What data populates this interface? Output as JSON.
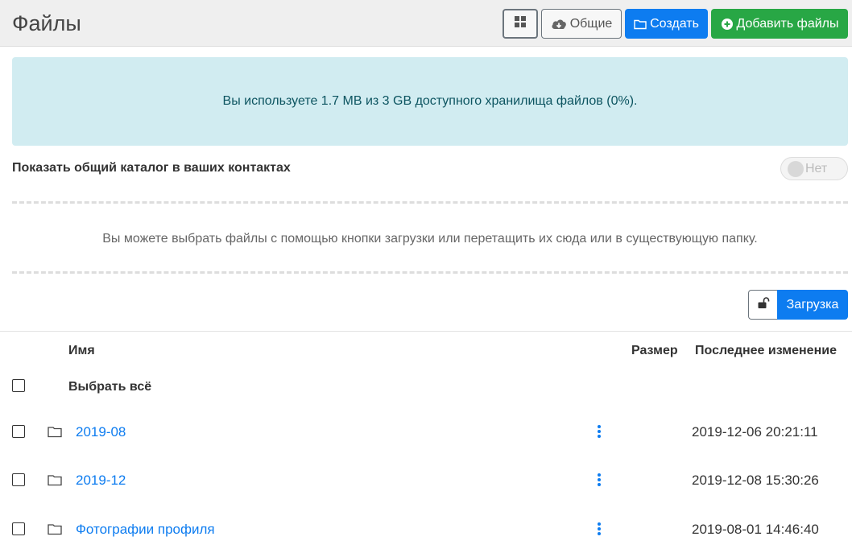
{
  "header": {
    "title": "Файлы",
    "buttons": {
      "grid_icon": "grid-icon",
      "shared_label": "Общие",
      "create_label": "Создать",
      "add_files_label": "Добавить файлы"
    }
  },
  "storage_alert": "Вы используете 1.7 MB из 3 GB доступного хранилища файлов (0%).",
  "catalog": {
    "label": "Показать общий каталог в ваших контактах",
    "toggle_label": "Нет"
  },
  "dropzone_text": "Вы можете выбрать файлы с помощью кнопки загрузки или перетащить их сюда или в существующую папку.",
  "upload_label": "Загрузка",
  "table": {
    "headers": {
      "name": "Имя",
      "size": "Размер",
      "modified": "Последнее изменение"
    },
    "select_all": "Выбрать всё",
    "rows": [
      {
        "name": "2019-08",
        "size": "",
        "modified": "2019-12-06 20:21:11"
      },
      {
        "name": "2019-12",
        "size": "",
        "modified": "2019-12-08 15:30:26"
      },
      {
        "name": "Фотографии профиля",
        "size": "",
        "modified": "2019-08-01 14:46:40"
      }
    ]
  },
  "colors": {
    "primary": "#0d7cf0",
    "success": "#28a745",
    "alert_bg": "#d1ecf1",
    "alert_text": "#0c5460"
  }
}
